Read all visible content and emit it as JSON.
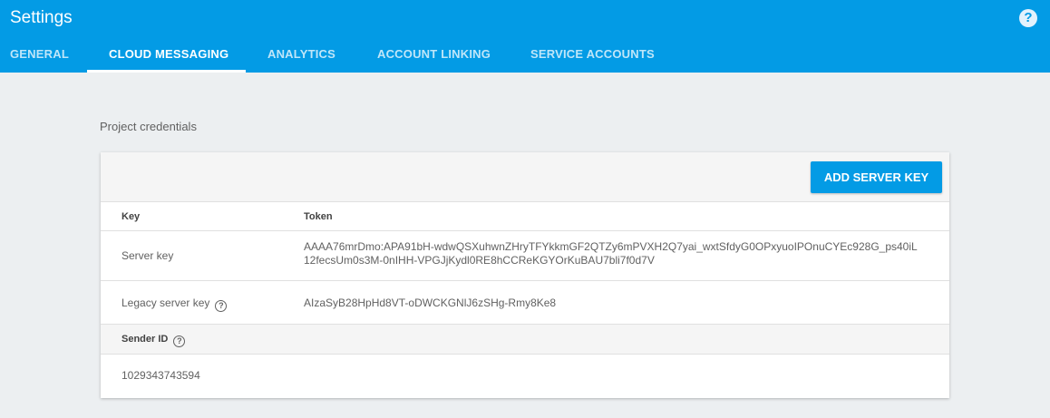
{
  "appbar": {
    "title": "Settings",
    "help_icon": "?"
  },
  "tabs": [
    {
      "label": "GENERAL",
      "active": false
    },
    {
      "label": "CLOUD MESSAGING",
      "active": true
    },
    {
      "label": "ANALYTICS",
      "active": false
    },
    {
      "label": "ACCOUNT LINKING",
      "active": false
    },
    {
      "label": "SERVICE ACCOUNTS",
      "active": false
    }
  ],
  "section": {
    "title": "Project credentials"
  },
  "toolbar": {
    "add_key_label": "ADD SERVER KEY"
  },
  "table": {
    "col_key": "Key",
    "col_token": "Token",
    "rows": [
      {
        "key": "Server key",
        "token": "AAAA76mrDmo:APA91bH-wdwQSXuhwnZHryTFYkkmGF2QTZy6mPVXH2Q7yai_wxtSfdyG0OPxyuoIPOnuCYEc928G_ps40iL12fecsUm0s3M-0nIHH-VPGJjKydl0RE8hCCReKGYOrKuBAU7bli7f0d7V"
      },
      {
        "key": "Legacy server key",
        "token": "AIzaSyB28HpHd8VT-oDWCKGNlJ6zSHg-Rmy8Ke8"
      }
    ]
  },
  "sender": {
    "label": "Sender ID",
    "value": "1029343743594"
  },
  "info_icon": "?"
}
